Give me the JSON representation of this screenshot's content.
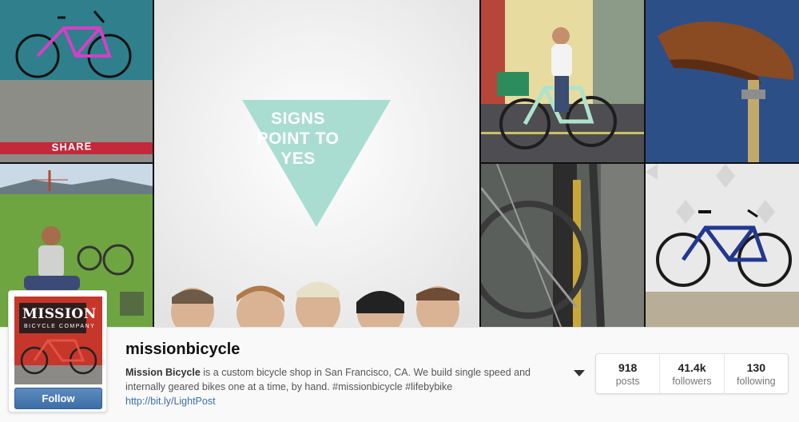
{
  "mosaic": {
    "signs_lines": [
      "SIGNS",
      "POINT TO",
      "YES"
    ],
    "share_stencil": "SHARE"
  },
  "avatar": {
    "logo_main": "MISSION",
    "logo_sub": "BICYCLE COMPANY"
  },
  "profile": {
    "username": "missionbicycle",
    "bio_name": "Mission Bicycle",
    "bio_text": " is a custom bicycle shop in San Francisco, CA. We build single speed and internally geared bikes one at a time, by hand. #missionbicycle #lifebybike",
    "link": "http://bit.ly/LightPost",
    "follow_label": "Follow"
  },
  "stats": [
    {
      "value": "918",
      "label": "posts"
    },
    {
      "value": "41.4k",
      "label": "followers"
    },
    {
      "value": "130",
      "label": "following"
    }
  ],
  "colors": {
    "teal_wall": "#2f7f8c",
    "mint_triangle": "#a9ddd2",
    "follow_blue": "#3d6fa5",
    "link_blue": "#3b6fa6",
    "avatar_red": "#c6362b"
  },
  "icons": [
    "caret-down-icon"
  ]
}
